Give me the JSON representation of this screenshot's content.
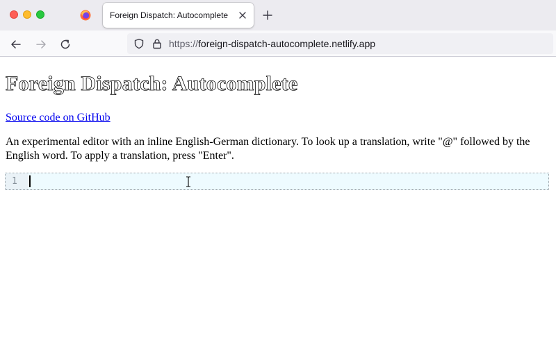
{
  "window": {
    "traffic_colors": {
      "close": "#fe5f57",
      "minimize": "#febc2e",
      "zoom": "#28c840"
    }
  },
  "tab": {
    "title": "Foreign Dispatch: Autocomplete"
  },
  "address_bar": {
    "scheme": "https://",
    "host": "foreign-dispatch-autocomplete.netlify.app"
  },
  "page": {
    "title": "Foreign Dispatch: Autocomplete",
    "source_link": "Source code on GitHub",
    "description": "An experimental editor with an inline English-German dictionary. To look up a translation, write \"@\" followed by the English word. To apply a translation, press \"Enter\".",
    "editor": {
      "line_number": "1",
      "content": ""
    }
  },
  "colors": {
    "link": "#0000ee",
    "editor_background": "#eefbff"
  }
}
